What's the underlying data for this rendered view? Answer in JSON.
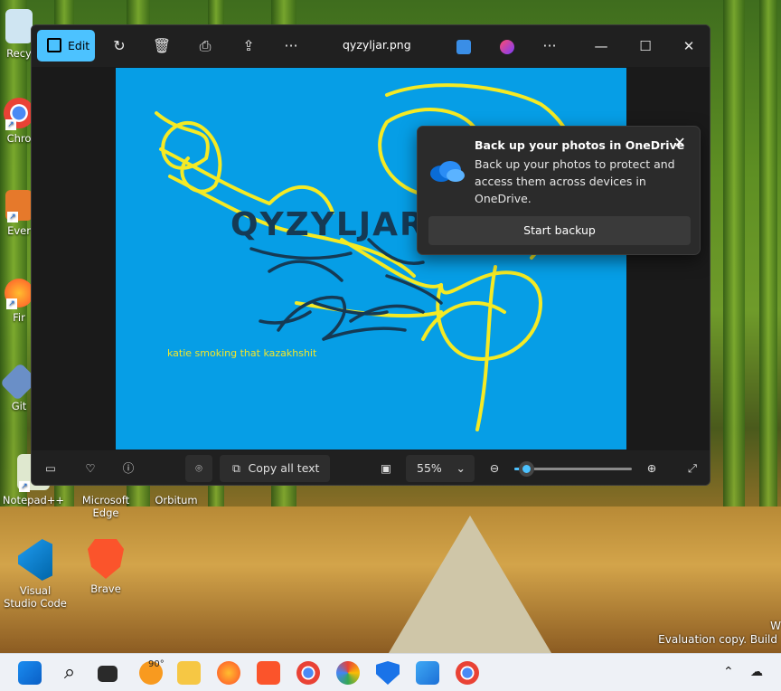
{
  "desktop": {
    "icons": [
      {
        "label": "Recy"
      },
      {
        "label": "Chro"
      },
      {
        "label": "Ever"
      },
      {
        "label": "Fir"
      },
      {
        "label": "Git"
      },
      {
        "label": "Notepad++"
      },
      {
        "label": "Microsoft Edge"
      },
      {
        "label": "Orbitum"
      },
      {
        "label": "Visual Studio Code"
      },
      {
        "label": "Brave"
      }
    ],
    "watermark_w": "W",
    "watermark": "Evaluation copy. Build"
  },
  "window": {
    "title": "qyzyljar.png",
    "edit_label": "Edit",
    "toolbar_icons": [
      "rotate-icon",
      "delete-icon",
      "print-icon",
      "share-icon",
      "more-icon"
    ],
    "title_icons": [
      "editor-app-icon",
      "clipchamp-icon",
      "more-icon"
    ],
    "controls": {
      "minimize": "—",
      "maximize": "☐",
      "close": "✕"
    }
  },
  "image": {
    "word": "QYZYLJAR",
    "caption": "katie smoking that kazakhshit",
    "bg_color": "#069ee6",
    "scribble_color": "#f5ea24"
  },
  "toast": {
    "title": "Back up your photos in OneDrive",
    "body": "Back up your photos to protect and access them across devices in OneDrive.",
    "button": "Start backup",
    "close": "✕"
  },
  "bottombar": {
    "copy_all_text": "Copy all text",
    "zoom": "55%",
    "zoom_level": 0.1
  },
  "taskbar": {
    "weather": "90°",
    "accent": "#4cc2ff"
  }
}
